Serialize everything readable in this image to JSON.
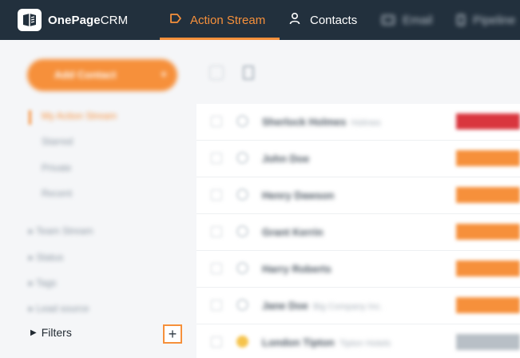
{
  "app": {
    "logo_bold": "OnePage",
    "logo_light": "CRM"
  },
  "nav": {
    "items": [
      {
        "label": "Action Stream",
        "icon": "action-stream-icon",
        "active": true
      },
      {
        "label": "Contacts",
        "icon": "person-icon",
        "active": false
      },
      {
        "label": "Email",
        "icon": "email-icon",
        "active": false
      },
      {
        "label": "Pipeline",
        "icon": "pipeline-icon",
        "active": false
      }
    ]
  },
  "sidebar": {
    "add_button": "Add Contact",
    "links": [
      "My Action Stream",
      "Starred",
      "Private",
      "Recent"
    ],
    "groups": [
      "Team Stream",
      "Status",
      "Tags",
      "Lead source"
    ],
    "filters_label": "Filters",
    "filters_add": "+"
  },
  "rows": [
    {
      "name": "Sherlock Holmes",
      "company": "Holmes",
      "tag": "#d9363e"
    },
    {
      "name": "John Doe",
      "company": "",
      "tag": "#f6903b"
    },
    {
      "name": "Henry Dawson",
      "company": "",
      "tag": "#f6903b"
    },
    {
      "name": "Grant Kerrin",
      "company": "",
      "tag": "#f6903b"
    },
    {
      "name": "Harry Roberts",
      "company": "",
      "tag": "#f6903b"
    },
    {
      "name": "Jane Doe",
      "company": "Big Company Inc.",
      "tag": "#f6903b"
    },
    {
      "name": "London Tipton",
      "company": "Tipton Hotels",
      "tag": "#b8bfc6"
    }
  ],
  "colors": {
    "accent": "#f6903b",
    "topbar": "#22303d"
  }
}
